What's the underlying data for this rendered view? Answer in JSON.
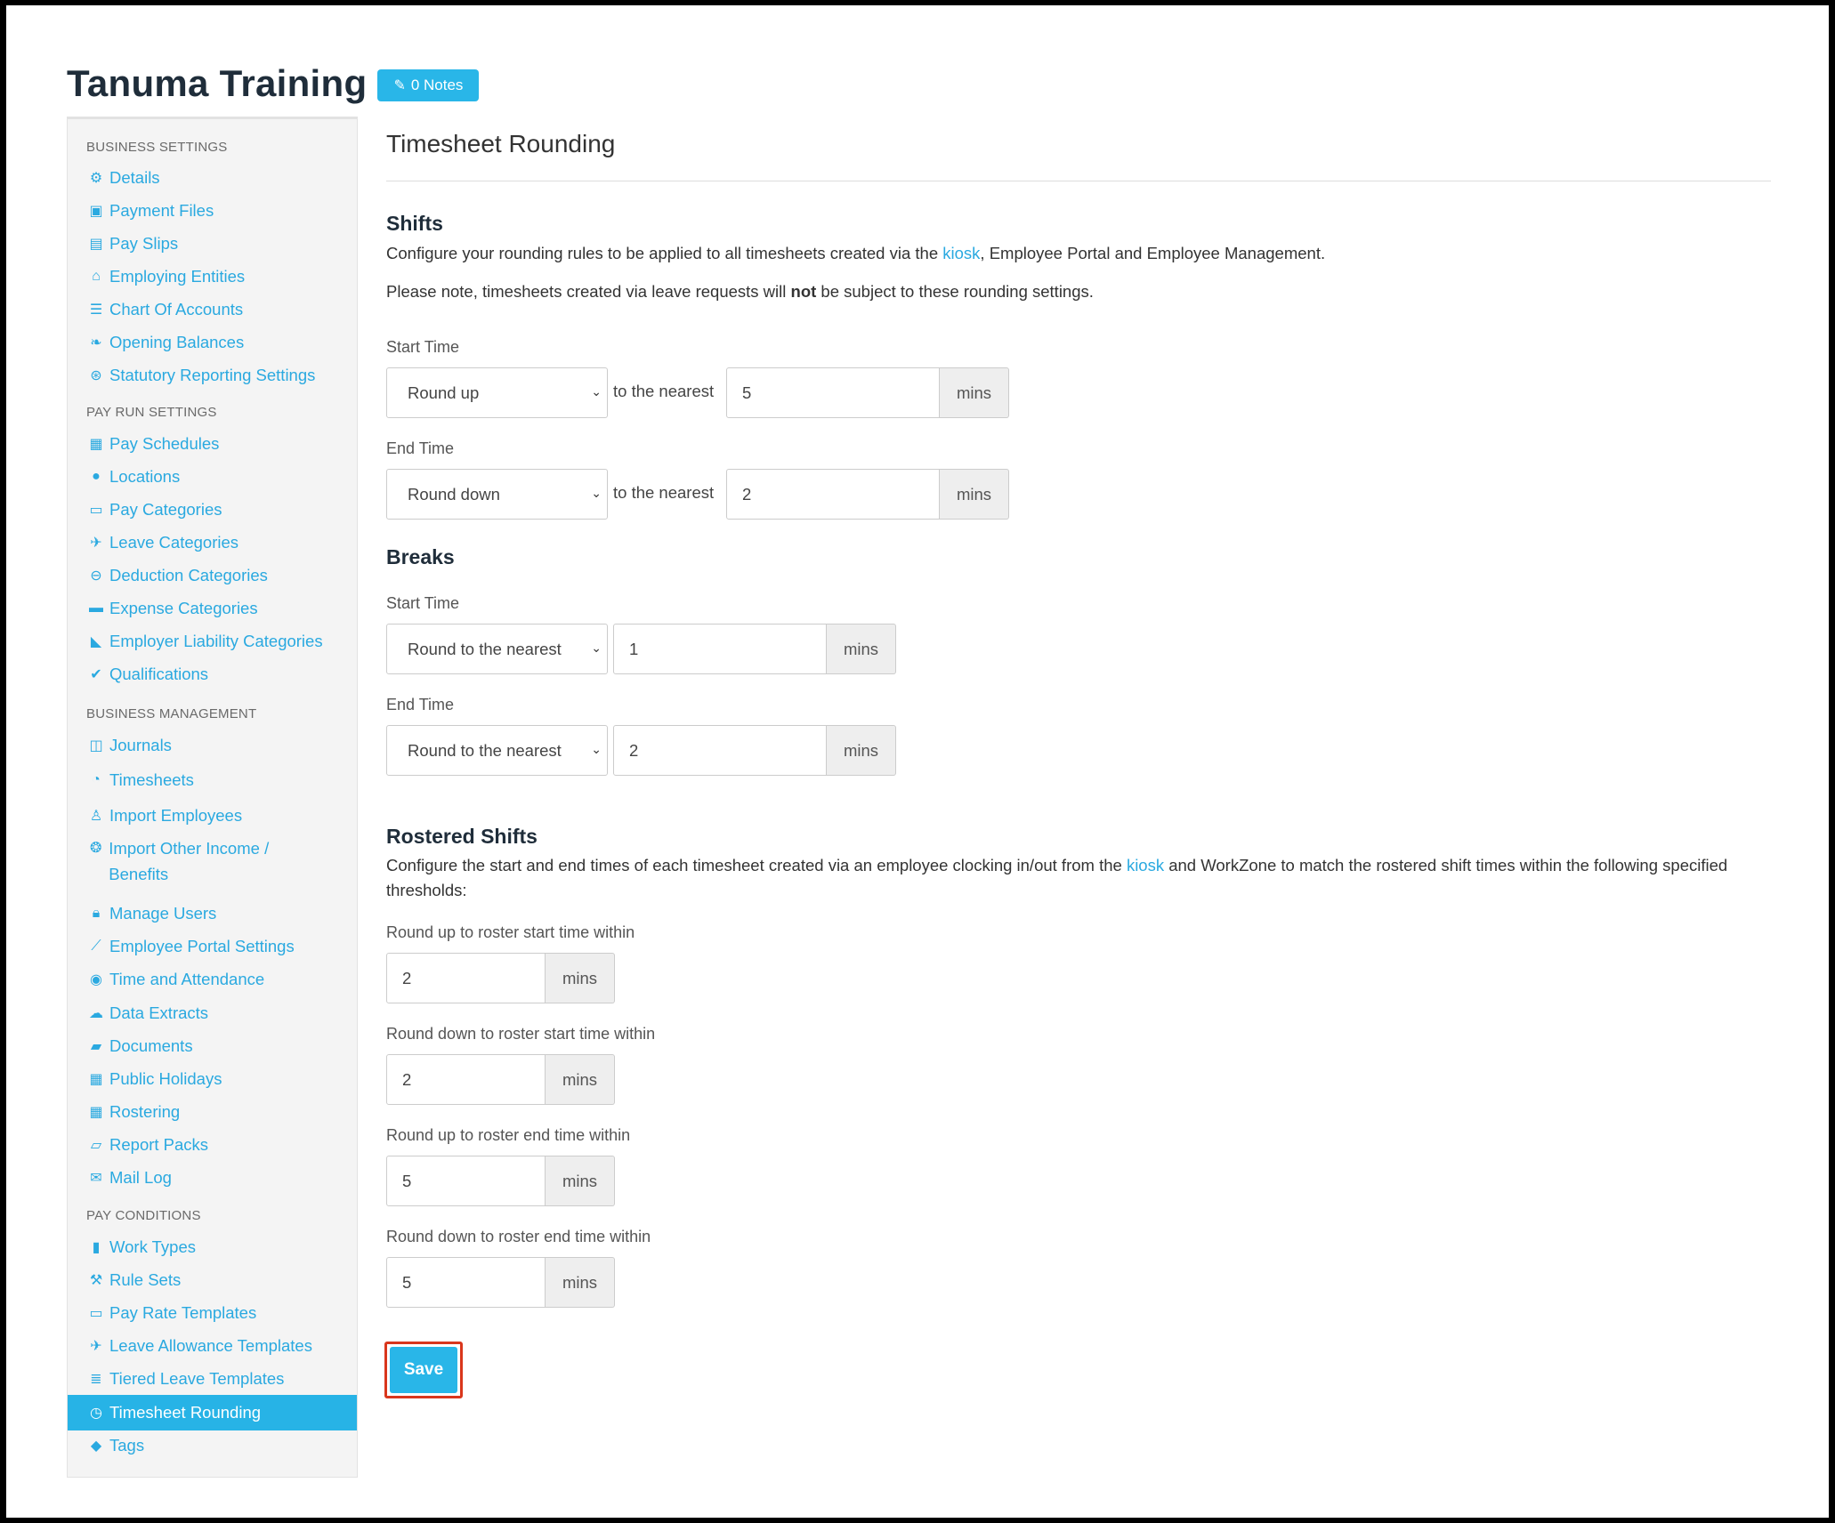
{
  "header": {
    "business_name": "Tanuma Training",
    "notes_label": "0 Notes"
  },
  "sidebar": {
    "sections": {
      "business_settings": "BUSINESS SETTINGS",
      "pay_run_settings": "PAY RUN SETTINGS",
      "business_management": "BUSINESS MANAGEMENT",
      "pay_conditions": "PAY CONDITIONS"
    },
    "items": {
      "details": "Details",
      "payment_files": "Payment Files",
      "pay_slips": "Pay Slips",
      "employing_entities": "Employing Entities",
      "chart_of_accounts": "Chart Of Accounts",
      "opening_balances": "Opening Balances",
      "statutory_reporting": "Statutory Reporting Settings",
      "pay_schedules": "Pay Schedules",
      "locations": "Locations",
      "pay_categories": "Pay Categories",
      "leave_categories": "Leave Categories",
      "deduction_categories": "Deduction Categories",
      "expense_categories": "Expense Categories",
      "employer_liability": "Employer Liability Categories",
      "qualifications": "Qualifications",
      "journals": "Journals",
      "timesheets": "Timesheets",
      "import_employees": "Import Employees",
      "import_other_income": "Import Other Income / Benefits",
      "manage_users": "Manage Users",
      "employee_portal": "Employee Portal Settings",
      "time_attendance": "Time and Attendance",
      "data_extracts": "Data Extracts",
      "documents": "Documents",
      "public_holidays": "Public Holidays",
      "rostering": "Rostering",
      "report_packs": "Report Packs",
      "mail_log": "Mail Log",
      "work_types": "Work Types",
      "rule_sets": "Rule Sets",
      "pay_rate_templates": "Pay Rate Templates",
      "leave_allowance": "Leave Allowance Templates",
      "tiered_leave": "Tiered Leave Templates",
      "timesheet_rounding": "Timesheet Rounding",
      "tags": "Tags"
    }
  },
  "main": {
    "title": "Timesheet Rounding",
    "shifts": {
      "heading": "Shifts",
      "desc_before": "Configure your rounding rules to be applied to all timesheets created via the ",
      "desc_link": "kiosk",
      "desc_after": ", Employee Portal and Employee Management.",
      "note_before": "Please note, timesheets created via leave requests will ",
      "note_bold": "not",
      "note_after": " be subject to these rounding settings.",
      "start_label": "Start Time",
      "start_select": "Round up",
      "start_value": "5",
      "end_label": "End Time",
      "end_select": "Round down",
      "end_value": "2",
      "nearest_text": "to the nearest"
    },
    "breaks": {
      "heading": "Breaks",
      "start_label": "Start Time",
      "start_select": "Round to the nearest",
      "start_value": "1",
      "end_label": "End Time",
      "end_select": "Round to the nearest",
      "end_value": "2"
    },
    "rostered": {
      "heading": "Rostered Shifts",
      "desc_before": "Configure the start and end times of each timesheet created via an employee clocking in/out from the ",
      "desc_link": "kiosk",
      "desc_after": " and WorkZone to match the rostered shift times within the following specified thresholds:",
      "up_start_label": "Round up to roster start time within",
      "up_start_value": "2",
      "down_start_label": "Round down to roster start time within",
      "down_start_value": "2",
      "up_end_label": "Round up to roster end time within",
      "up_end_value": "5",
      "down_end_label": "Round down to roster end time within",
      "down_end_value": "5"
    },
    "unit": "mins",
    "save_label": "Save"
  },
  "colors": {
    "accent": "#29b6e8",
    "highlight": "#d9361c"
  }
}
